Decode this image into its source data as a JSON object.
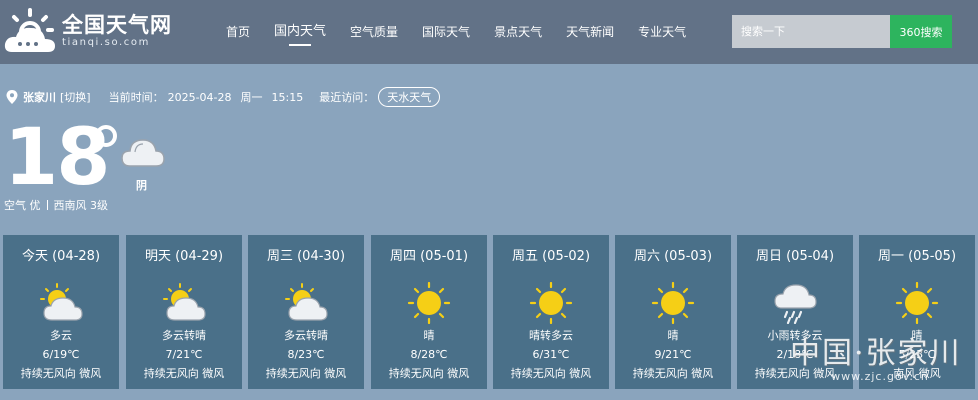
{
  "header": {
    "brand_name": "全国天气网",
    "brand_url": "tianqi.so.com",
    "nav": [
      {
        "label": "首页"
      },
      {
        "label": "国内天气",
        "active": true
      },
      {
        "label": "空气质量"
      },
      {
        "label": "国际天气"
      },
      {
        "label": "景点天气"
      },
      {
        "label": "天气新闻"
      },
      {
        "label": "专业天气"
      }
    ],
    "search": {
      "placeholder": "搜索一下",
      "button_label": "360搜索"
    }
  },
  "location": {
    "city": "张家川",
    "switch_label": "[切换]",
    "time_label": "当前时间：",
    "date": "2025-04-28",
    "weekday": "周一",
    "time": "15:15",
    "recent_label": "最近访问：",
    "recent_city": "天水天气"
  },
  "current": {
    "temperature": "18",
    "condition": "阴",
    "air_quality": "空气 优",
    "wind": "西南风 3级",
    "icon": "cloudy-icon"
  },
  "forecast": [
    {
      "title": "今天 (04-28)",
      "condition": "多云",
      "temp": "6/19℃",
      "wind": "持续无风向 微风",
      "icon": "partly-cloudy-icon"
    },
    {
      "title": "明天 (04-29)",
      "condition": "多云转晴",
      "temp": "7/21℃",
      "wind": "持续无风向 微风",
      "icon": "partly-cloudy-icon"
    },
    {
      "title": "周三 (04-30)",
      "condition": "多云转晴",
      "temp": "8/23℃",
      "wind": "持续无风向 微风",
      "icon": "partly-cloudy-icon"
    },
    {
      "title": "周四 (05-01)",
      "condition": "晴",
      "temp": "8/28℃",
      "wind": "持续无风向 微风",
      "icon": "sunny-icon"
    },
    {
      "title": "周五 (05-02)",
      "condition": "晴转多云",
      "temp": "6/31℃",
      "wind": "持续无风向 微风",
      "icon": "sunny-icon"
    },
    {
      "title": "周六 (05-03)",
      "condition": "晴",
      "temp": "9/21℃",
      "wind": "持续无风向 微风",
      "icon": "sunny-icon"
    },
    {
      "title": "周日 (05-04)",
      "condition": "小雨转多云",
      "temp": "2/18℃",
      "wind": "持续无风向 微风",
      "icon": "light-rain-icon"
    },
    {
      "title": "周一 (05-05)",
      "condition": "晴",
      "temp": "5/23℃",
      "wind": "南风 微风",
      "icon": "sunny-icon"
    }
  ],
  "watermark": {
    "text": "中国·张家川",
    "url": "www.zjc.gov.cn"
  },
  "colors": {
    "header_bg": "#627287",
    "page_bg": "#8aa4bd",
    "card_bg": "#4a7089",
    "search_button": "#2db45e",
    "sun": "#f5cf16"
  }
}
